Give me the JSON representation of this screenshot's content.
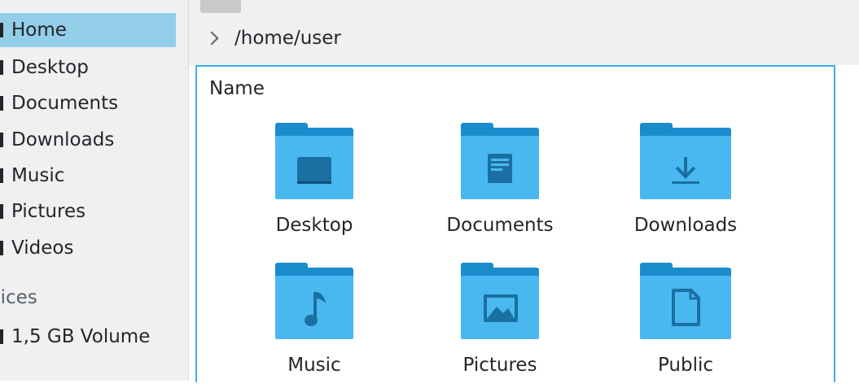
{
  "sidebar": {
    "places": [
      {
        "label": "Home",
        "icon": "home-icon",
        "active": true
      },
      {
        "label": "Desktop",
        "icon": "desktop-icon"
      },
      {
        "label": "Documents",
        "icon": "documents-icon"
      },
      {
        "label": "Downloads",
        "icon": "downloads-icon"
      },
      {
        "label": "Music",
        "icon": "music-icon"
      },
      {
        "label": "Pictures",
        "icon": "pictures-icon"
      },
      {
        "label": "Videos",
        "icon": "videos-icon"
      }
    ],
    "devices_header": "vices",
    "devices": [
      {
        "label": "1,5 GB Volume",
        "icon": "drive-icon"
      }
    ]
  },
  "location": {
    "path": "/home/user"
  },
  "view": {
    "column_header": "Name",
    "items": [
      {
        "label": "Desktop",
        "icon": "folder-desktop-icon"
      },
      {
        "label": "Documents",
        "icon": "folder-documents-icon"
      },
      {
        "label": "Downloads",
        "icon": "folder-downloads-icon"
      },
      {
        "label": "Music",
        "icon": "folder-music-icon"
      },
      {
        "label": "Pictures",
        "icon": "folder-pictures-icon"
      },
      {
        "label": "Public",
        "icon": "folder-public-icon"
      }
    ]
  },
  "colors": {
    "accent": "#3daee9",
    "selection": "#93cee9",
    "folder_front": "#4ab8f0",
    "folder_back": "#1a8ccc",
    "panel_bg": "#eff0f1"
  }
}
